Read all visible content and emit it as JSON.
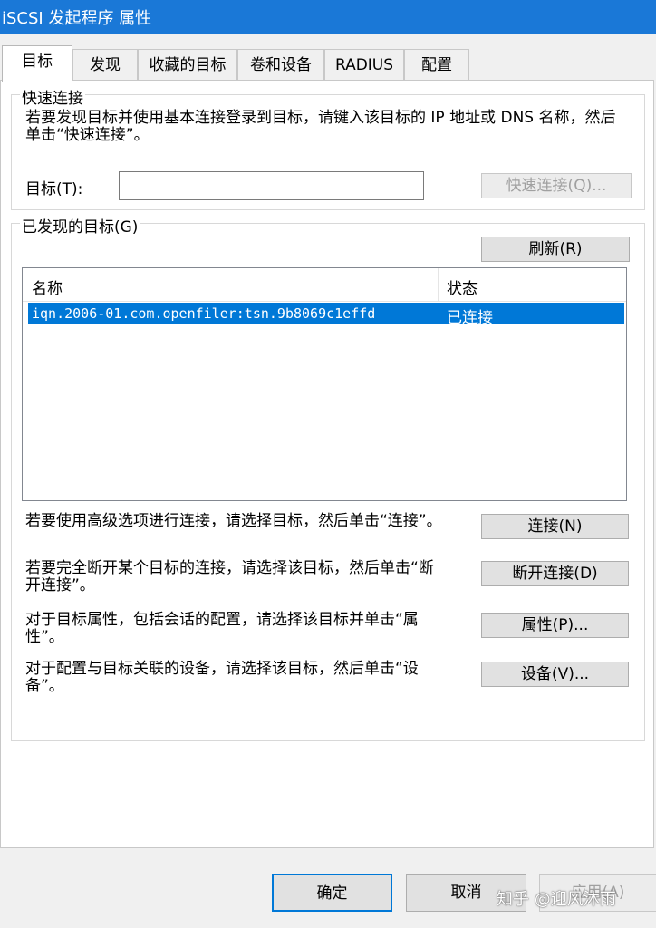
{
  "window": {
    "title": "iSCSI 发起程序 属性"
  },
  "tabs": [
    {
      "label": "目标",
      "active": true
    },
    {
      "label": "发现",
      "active": false
    },
    {
      "label": "收藏的目标",
      "active": false
    },
    {
      "label": "卷和设备",
      "active": false
    },
    {
      "label": "RADIUS",
      "active": false
    },
    {
      "label": "配置",
      "active": false
    }
  ],
  "quick_connect": {
    "legend": "快速连接",
    "description": "若要发现目标并使用基本连接登录到目标，请键入该目标的 IP 地址或 DNS 名称，然后单击“快速连接”。",
    "target_label": "目标(T):",
    "target_value": "",
    "button_label": "快速连接(Q)...",
    "button_enabled": false
  },
  "discovered": {
    "legend": "已发现的目标(G)",
    "refresh_label": "刷新(R)",
    "columns": [
      "名称",
      "状态"
    ],
    "rows": [
      {
        "name": "iqn.2006-01.com.openfiler:tsn.9b8069c1effd",
        "status": "已连接",
        "selected": true
      }
    ]
  },
  "actions": [
    {
      "description": "若要使用高级选项进行连接，请选择目标，然后单击“连接”。",
      "button": "连接(N)"
    },
    {
      "description": "若要完全断开某个目标的连接，请选择该目标，然后单击“断开连接”。",
      "button": "断开连接(D)"
    },
    {
      "description": "对于目标属性，包括会话的配置，请选择该目标并单击“属性”。",
      "button": "属性(P)..."
    },
    {
      "description": "对于配置与目标关联的设备，请选择该目标，然后单击“设备”。",
      "button": "设备(V)..."
    }
  ],
  "footer": {
    "ok_label": "确定",
    "cancel_label": "取消",
    "apply_label": "应用(A)",
    "apply_enabled": false
  },
  "watermark": "知乎 @迎风沐雨",
  "colors": {
    "titlebar": "#1a78d7",
    "selection": "#0078d7",
    "default_button_border": "#0078d7"
  }
}
